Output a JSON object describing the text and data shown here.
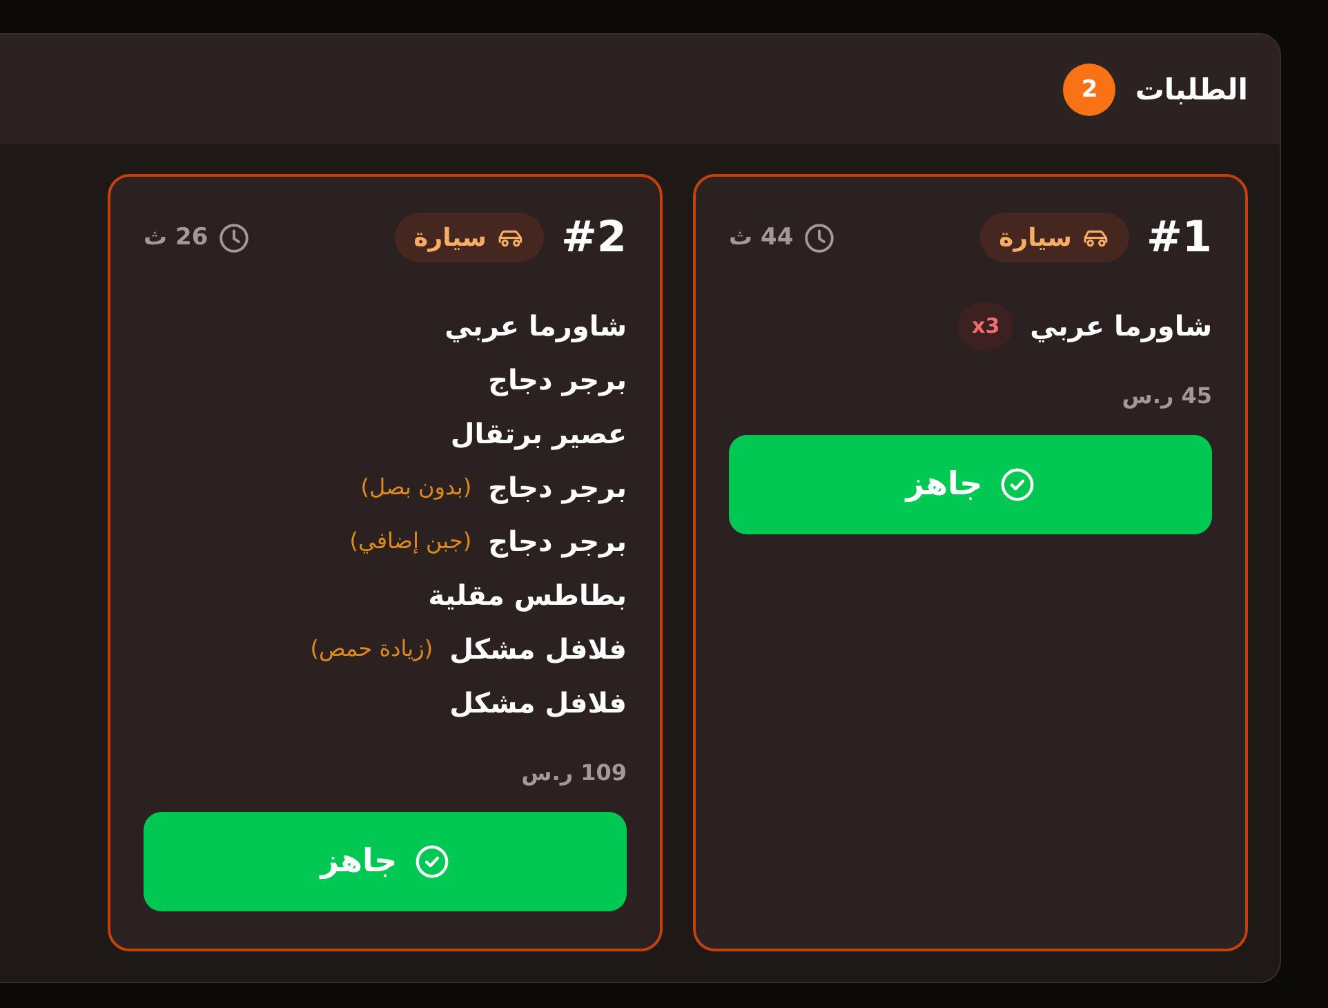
{
  "panel": {
    "title": "الطلبات",
    "count": "2"
  },
  "orders": [
    {
      "number": "#1",
      "order_type": {
        "kind": "car",
        "label": "سيارة"
      },
      "elapsed": "44 ث",
      "items": [
        {
          "name": "شاورما عربي",
          "quantity": "x3"
        }
      ],
      "total": "45 ر.س",
      "action": "جاهز"
    },
    {
      "number": "#2",
      "order_type": {
        "kind": "car",
        "label": "سيارة"
      },
      "elapsed": "26 ث",
      "items": [
        {
          "name": "شاورما عربي"
        },
        {
          "name": "برجر دجاج"
        },
        {
          "name": "عصير برتقال"
        },
        {
          "name": "برجر دجاج",
          "note": "(بدون بصل)"
        },
        {
          "name": "برجر دجاج",
          "note": "(جبن إضافي)"
        },
        {
          "name": "بطاطس مقلية"
        },
        {
          "name": "فلافل مشكل",
          "note": "(زيادة حمص)"
        },
        {
          "name": "فلافل مشكل"
        }
      ],
      "total": "109 ر.س",
      "action": "جاهز"
    }
  ]
}
